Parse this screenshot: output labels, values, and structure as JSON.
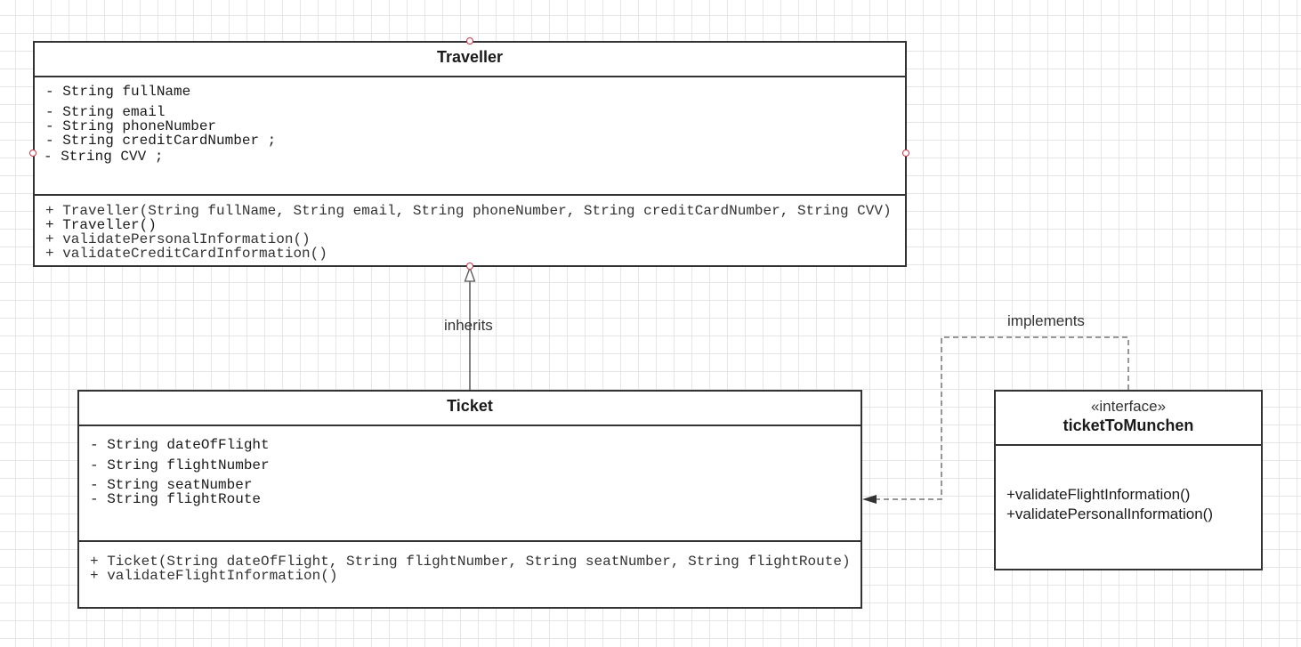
{
  "traveller": {
    "name": "Traveller",
    "attributes": [
      "- String fullName",
      "- String email",
      "- String phoneNumber",
      "- String creditCardNumber ;",
      "- String CVV ;"
    ],
    "operations": [
      "+ Traveller(String fullName, String email, String phoneNumber, String creditCardNumber, String CVV)",
      "+ Traveller()",
      "+ validatePersonalInformation()",
      "+ validateCreditCardInformation()"
    ]
  },
  "ticket": {
    "name": "Ticket",
    "attributes": [
      "- String dateOfFlight",
      "- String flightNumber",
      "- String seatNumber",
      "- String flightRoute"
    ],
    "operations": [
      "+ Ticket(String dateOfFlight, String flightNumber, String seatNumber, String flightRoute)",
      "+ validateFlightInformation()"
    ]
  },
  "interface": {
    "stereotype": "«interface»",
    "name": "ticketToMunchen",
    "operations": [
      "+validateFlightInformation()",
      "+validatePersonalInformation()"
    ]
  },
  "connectors": {
    "inherits_label": "inherits",
    "implements_label": "implements"
  },
  "colors": {
    "border": "#333333",
    "grid": "#e6e6e6",
    "handle": "#cc3344"
  }
}
